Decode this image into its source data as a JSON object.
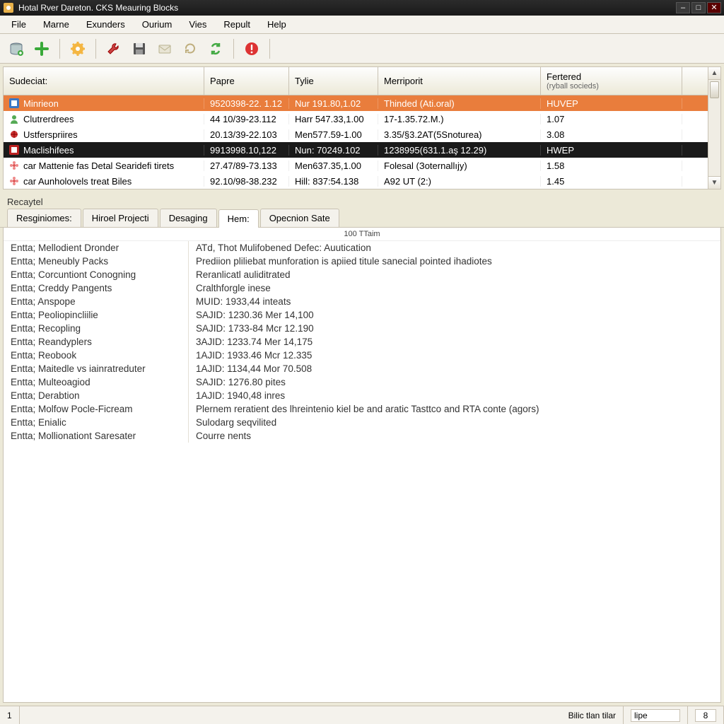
{
  "window": {
    "title": "Hotal Rver Dareton. CKS Meauring Blocks"
  },
  "menu": [
    "File",
    "Marne",
    "Exunders",
    "Ourium",
    "Vies",
    "Repult",
    "Help"
  ],
  "toolbar_icons": [
    "database-icon",
    "plus-icon",
    "gear-icon",
    "wrench-icon",
    "save-icon",
    "mail-icon",
    "refresh-icon",
    "sync-icon",
    "alert-icon"
  ],
  "list": {
    "columns": [
      {
        "label": "Sudeciat:",
        "sub": ""
      },
      {
        "label": "Papre",
        "sub": ""
      },
      {
        "label": "Tylie",
        "sub": ""
      },
      {
        "label": "Merriporit",
        "sub": ""
      },
      {
        "label": "Fertered",
        "sub": "(ryball socieds)"
      }
    ],
    "rows": [
      {
        "style": "orange",
        "icon": "app-icon",
        "cells": [
          "Minrieon",
          "9520398-22. 1.12",
          "Nur 191.80,1.02",
          "Thinded (Ati.oral)",
          "HUVEP"
        ]
      },
      {
        "style": "",
        "icon": "user-green-icon",
        "cells": [
          "Clutrerdrees",
          "44 10/39-23.112",
          "Harr 547.33,1.00",
          "17-1.35.72.M.)",
          "1.07"
        ]
      },
      {
        "style": "",
        "icon": "bug-red-icon",
        "cells": [
          "Ustferspriires",
          "20.13/39-22.103",
          "Men577.59-1.00",
          "3.35/§3.2AT(5Snoturea)",
          "3.08"
        ]
      },
      {
        "style": "black",
        "icon": "app-red-icon",
        "cells": [
          "Maclishifees",
          "9913998.10,122",
          "Nun: 70249.102",
          "1238995(631.1.aş 12.29)",
          "HWEP"
        ]
      },
      {
        "style": "",
        "icon": "flower-icon",
        "cells": [
          "car Mattenie fas Detal Searidefi tirets",
          "27.47/89-73.133",
          "Men637.35,1.00",
          "Folesal (Зoternallıjy)",
          "1.58"
        ]
      },
      {
        "style": "",
        "icon": "flower-icon",
        "cells": [
          "car Aunholovels treat Biles",
          "92.10/98-38.232",
          "Hill: 837:54.138",
          "A92 UT (2:)",
          "1.45"
        ]
      }
    ]
  },
  "mid_label": "Recaytel",
  "tabs": [
    "Resginiomes:",
    "Hiroel Projecti",
    "Desaging",
    "Hem:",
    "Opecnion Sate"
  ],
  "active_tab": 3,
  "subheader": "100 TTaim",
  "details": [
    {
      "k": "Entta; Mellodient Dronder",
      "v": "ATd, Thot Mulifobened Defec: Auutication"
    },
    {
      "k": "Entta; Meneubly Packs",
      "v": "Prediion pliliebat munforation is apiied titule sanecial pointed ihadiotes"
    },
    {
      "k": "Entta; Corcuntiont Conogning",
      "v": "Reranlicatl auliditrated"
    },
    {
      "k": "Entta; Creddy Pangents",
      "v": "Cralthforgle inese"
    },
    {
      "k": "Entta; Anspope",
      "v": "MUID: 1933,44 inteats"
    },
    {
      "k": "Entta; Peoliopincliilіe",
      "v": "SAJID: 1230.36 Mer 14,100"
    },
    {
      "k": "Entta; Recopling",
      "v": "SAJID: 1733-84 Mcr 12.190"
    },
    {
      "k": "Entta; Reandyplers",
      "v": "3AJID: 1233.74 Mer 14,175"
    },
    {
      "k": "Entta; Reobook",
      "v": "1AJID: 1933.46 Mcr 12.335"
    },
    {
      "k": "Entta; Maitedle vs iainratreduter",
      "v": "1AJID: 1134,44 Mor 70.508"
    },
    {
      "k": "Entta; Multeoagіod",
      "v": "SAJID: 1276.80 pites"
    },
    {
      "k": "Entta; Derabtion",
      "v": "1AJID: 1940,48 inres"
    },
    {
      "k": "Entta; Molfow Pocle-Ficream",
      "v": "Plernem reratient des lhreintenio kiel be and aratic Tasttco and RTA conte (agors)"
    },
    {
      "k": "Entta; Enialic",
      "v": "Sulodarg seqvilited"
    },
    {
      "k": "Entta; Mollionationt Saresater",
      "v": "Courre nents"
    }
  ],
  "status": {
    "left": "1",
    "right_label": "Bilic tlan tilar",
    "input_value": "lipe",
    "page": "8"
  },
  "colors": {
    "row_orange": "#e97d3c",
    "row_black": "#1a1a1a"
  }
}
